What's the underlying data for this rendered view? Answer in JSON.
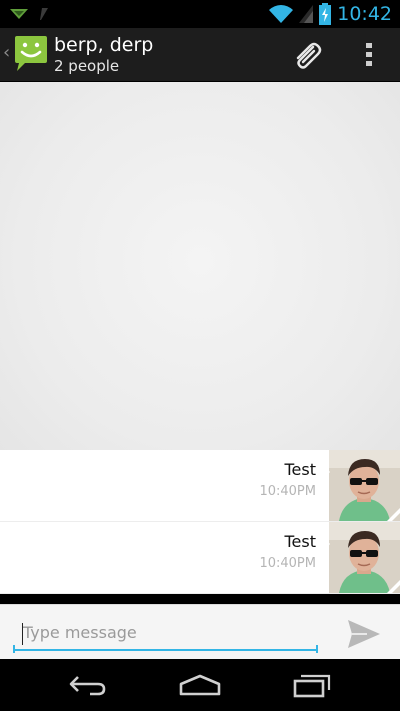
{
  "status_bar": {
    "time": "10:42",
    "icons": [
      "notification-icon",
      "download-icon",
      "wifi-icon",
      "signal-icon",
      "battery-icon"
    ]
  },
  "action_bar": {
    "title": "berp, derp",
    "subtitle": "2 people",
    "icons": [
      "up-caret-icon",
      "messaging-app-icon",
      "paperclip-icon",
      "overflow-menu-icon"
    ]
  },
  "messages": [
    {
      "text": "Test",
      "time": "10:40PM"
    },
    {
      "text": "Test",
      "time": "10:40PM"
    }
  ],
  "compose": {
    "placeholder": "Type message",
    "value": ""
  },
  "navigation": {
    "buttons": [
      "back-icon",
      "home-icon",
      "recent-apps-icon"
    ]
  },
  "colors": {
    "accent": "#33b5e5",
    "action_bar": "#1d1d1d",
    "app_icon": "#8cc63f"
  }
}
